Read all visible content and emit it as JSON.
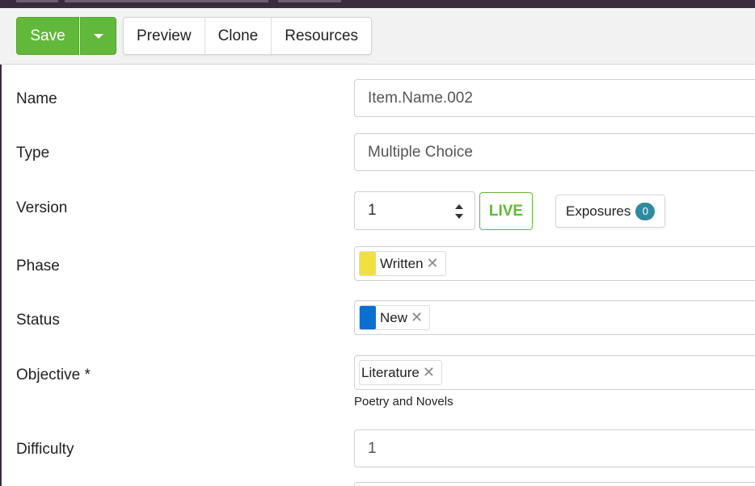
{
  "toolbar": {
    "save_label": "Save",
    "buttons": [
      "Preview",
      "Clone",
      "Resources"
    ]
  },
  "form": {
    "name": {
      "label": "Name",
      "value": "Item.Name.002"
    },
    "type": {
      "label": "Type",
      "value": "Multiple Choice"
    },
    "version": {
      "label": "Version",
      "value": "1",
      "status": "LIVE",
      "exposures_label": "Exposures",
      "exposures_count": "0"
    },
    "phase": {
      "label": "Phase",
      "tag": "Written",
      "tag_color": "#f0e040"
    },
    "status": {
      "label": "Status",
      "tag": "New",
      "tag_color": "#0a6fd1"
    },
    "objective": {
      "label": "Objective *",
      "tag": "Literature",
      "hint": "Poetry and Novels"
    },
    "difficulty": {
      "label": "Difficulty",
      "value": "1"
    }
  },
  "colors": {
    "accent_green": "#62b83a",
    "badge_teal": "#2f8aa0",
    "topbar": "#3b2b3f"
  }
}
